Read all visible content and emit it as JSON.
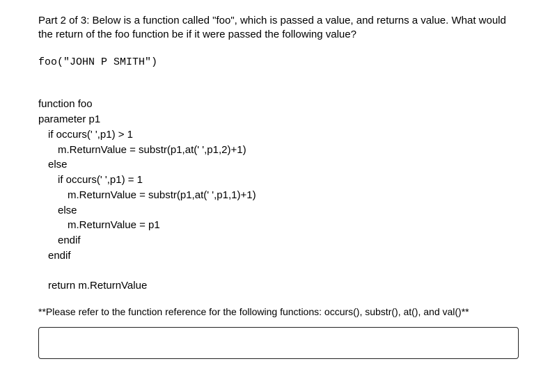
{
  "intro": "Part 2 of 3: Below is a function called \"foo\", which is passed a value, and returns a value. What would the return of the foo function be if it were passed the following value?",
  "call": "foo(\"JOHN P SMITH\")",
  "code": {
    "l1": "function foo",
    "l2": "parameter p1",
    "l3": "if occurs(' ',p1) > 1",
    "l4": "m.ReturnValue = substr(p1,at(' ',p1,2)+1)",
    "l5": "else",
    "l6": "if occurs(' ',p1) = 1",
    "l7": "m.ReturnValue = substr(p1,at(' ',p1,1)+1)",
    "l8": "else",
    "l9": "m.ReturnValue = p1",
    "l10": "endif",
    "l11": "endif",
    "l12": "return m.ReturnValue"
  },
  "note": "**Please refer to the function reference for the following functions: occurs(), substr(), at(), and val()**",
  "answer_placeholder": ""
}
